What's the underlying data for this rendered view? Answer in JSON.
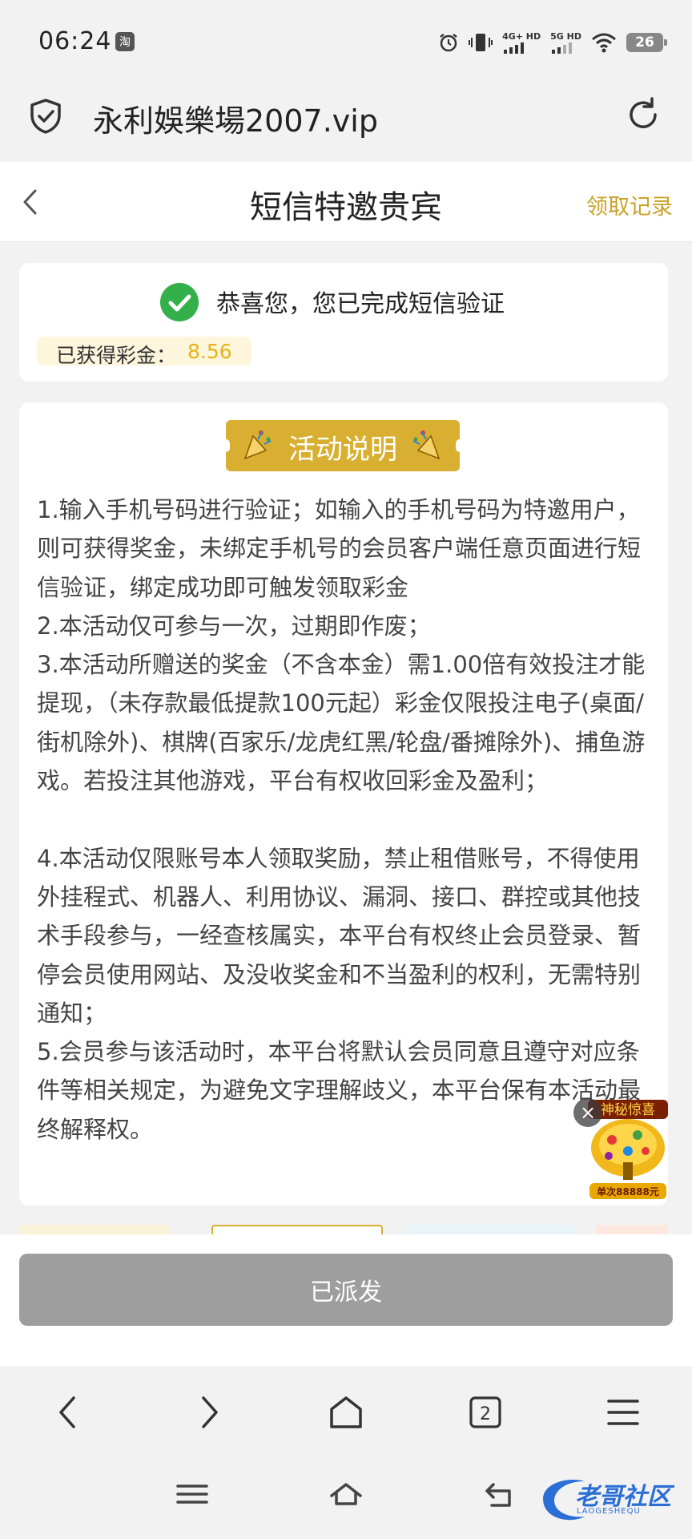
{
  "status_bar": {
    "time": "06:24",
    "app_badge": "淘",
    "network_1": "4G+ HD",
    "network_2": "5G HD",
    "battery": "26"
  },
  "browser": {
    "url": "永利娛樂場2007.vip",
    "tab_count": "2"
  },
  "header": {
    "title": "短信特邀贵宾",
    "records_link": "领取记录"
  },
  "verify_card": {
    "message": "恭喜您，您已完成短信验证",
    "bonus_label": "已获得彩金：",
    "bonus_value": "8.56"
  },
  "activity": {
    "title": "活动说明",
    "rules": [
      "1.输入手机号码进行验证；如输入的手机号码为特邀用户，则可获得奖金，未绑定手机号的会员客户端任意页面进行短信验证，绑定成功即可触发领取彩金",
      "2.本活动仅可参与一次，过期即作废；",
      "3.本活动所赠送的奖金（不含本金）需1.00倍有效投注才能提现，（未存款最低提款100元起）彩金仅限投注电子(桌面/街机除外)、棋牌(百家乐/龙虎红黑/轮盘/番摊除外)、捕鱼游戏。若投注其他游戏，平台有权收回彩金及盈利；",
      "4.本活动仅限账号本人领取奖励，禁止租借账号，不得使用外挂程式、机器人、利用协议、漏洞、接口、群控或其他技术手段参与，一经查核属实，本平台有权终止会员登录、暂停会员使用网站、及没收奖金和不当盈利的权利，无需特别通知；",
      "5.会员参与该活动时，本平台将默认会员同意且遵守对应条件等相关规定，为避免文字理解歧义，本平台保有本活动最终解释权。"
    ]
  },
  "promo": {
    "title": "神秘惊喜",
    "caption": "单次88888元"
  },
  "dispatch_button": "已派发",
  "watermark": {
    "text": "老哥社区",
    "sub": "LAOGESHEQU"
  },
  "colors": {
    "gold": "#d8af30",
    "link_gold": "#c9a227",
    "success_green": "#34b04a",
    "disabled_gray": "#9e9e9e"
  }
}
